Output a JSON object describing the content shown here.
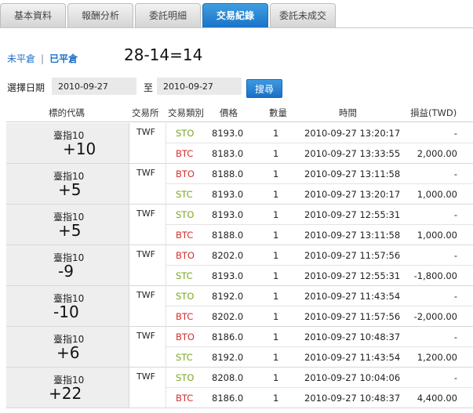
{
  "tabs": [
    {
      "label": "基本資料"
    },
    {
      "label": "報酬分析"
    },
    {
      "label": "委託明細"
    },
    {
      "label": "交易紀錄",
      "active": true
    },
    {
      "label": "委託未成交"
    }
  ],
  "filter": {
    "open_label": "未平倉",
    "separator": "|",
    "closed_label": "已平倉"
  },
  "summary": "28-14=14",
  "date_filter": {
    "label": "選擇日期",
    "from": "2010-09-27",
    "to_label": "至",
    "to": "2010-09-27",
    "search_label": "搜尋"
  },
  "columns": [
    "標的代碼",
    "交易所",
    "交易類別",
    "價格",
    "數量",
    "時間",
    "損益(TWD)"
  ],
  "groups": [
    {
      "symbol": "臺指10",
      "net": "+10",
      "exchange": "TWF",
      "trades": [
        {
          "type": "STO",
          "price": "8193.0",
          "qty": "1",
          "time": "2010-09-27 13:20:17",
          "pnl": "-"
        },
        {
          "type": "BTC",
          "price": "8183.0",
          "qty": "1",
          "time": "2010-09-27 13:33:55",
          "pnl": "2,000.00"
        }
      ]
    },
    {
      "symbol": "臺指10",
      "net": "+5",
      "exchange": "TWF",
      "trades": [
        {
          "type": "BTO",
          "price": "8188.0",
          "qty": "1",
          "time": "2010-09-27 13:11:58",
          "pnl": "-"
        },
        {
          "type": "STC",
          "price": "8193.0",
          "qty": "1",
          "time": "2010-09-27 13:20:17",
          "pnl": "1,000.00"
        }
      ]
    },
    {
      "symbol": "臺指10",
      "net": "+5",
      "exchange": "TWF",
      "trades": [
        {
          "type": "STO",
          "price": "8193.0",
          "qty": "1",
          "time": "2010-09-27 12:55:31",
          "pnl": "-"
        },
        {
          "type": "BTC",
          "price": "8188.0",
          "qty": "1",
          "time": "2010-09-27 13:11:58",
          "pnl": "1,000.00"
        }
      ]
    },
    {
      "symbol": "臺指10",
      "net": "-9",
      "exchange": "TWF",
      "trades": [
        {
          "type": "BTO",
          "price": "8202.0",
          "qty": "1",
          "time": "2010-09-27 11:57:56",
          "pnl": "-"
        },
        {
          "type": "STC",
          "price": "8193.0",
          "qty": "1",
          "time": "2010-09-27 12:55:31",
          "pnl": "-1,800.00"
        }
      ]
    },
    {
      "symbol": "臺指10",
      "net": "-10",
      "exchange": "TWF",
      "trades": [
        {
          "type": "STO",
          "price": "8192.0",
          "qty": "1",
          "time": "2010-09-27 11:43:54",
          "pnl": "-"
        },
        {
          "type": "BTC",
          "price": "8202.0",
          "qty": "1",
          "time": "2010-09-27 11:57:56",
          "pnl": "-2,000.00"
        }
      ]
    },
    {
      "symbol": "臺指10",
      "net": "+6",
      "exchange": "TWF",
      "trades": [
        {
          "type": "BTO",
          "price": "8186.0",
          "qty": "1",
          "time": "2010-09-27 10:48:37",
          "pnl": "-"
        },
        {
          "type": "STC",
          "price": "8192.0",
          "qty": "1",
          "time": "2010-09-27 11:43:54",
          "pnl": "1,200.00"
        }
      ]
    },
    {
      "symbol": "臺指10",
      "net": "+22",
      "exchange": "TWF",
      "trades": [
        {
          "type": "STO",
          "price": "8208.0",
          "qty": "1",
          "time": "2010-09-27 10:04:06",
          "pnl": "-"
        },
        {
          "type": "BTC",
          "price": "8186.0",
          "qty": "1",
          "time": "2010-09-27 10:48:37",
          "pnl": "4,400.00"
        }
      ]
    }
  ],
  "colors": {
    "sto": "#7aa820",
    "btc": "#d0312d",
    "accent": "#1a73c9"
  }
}
